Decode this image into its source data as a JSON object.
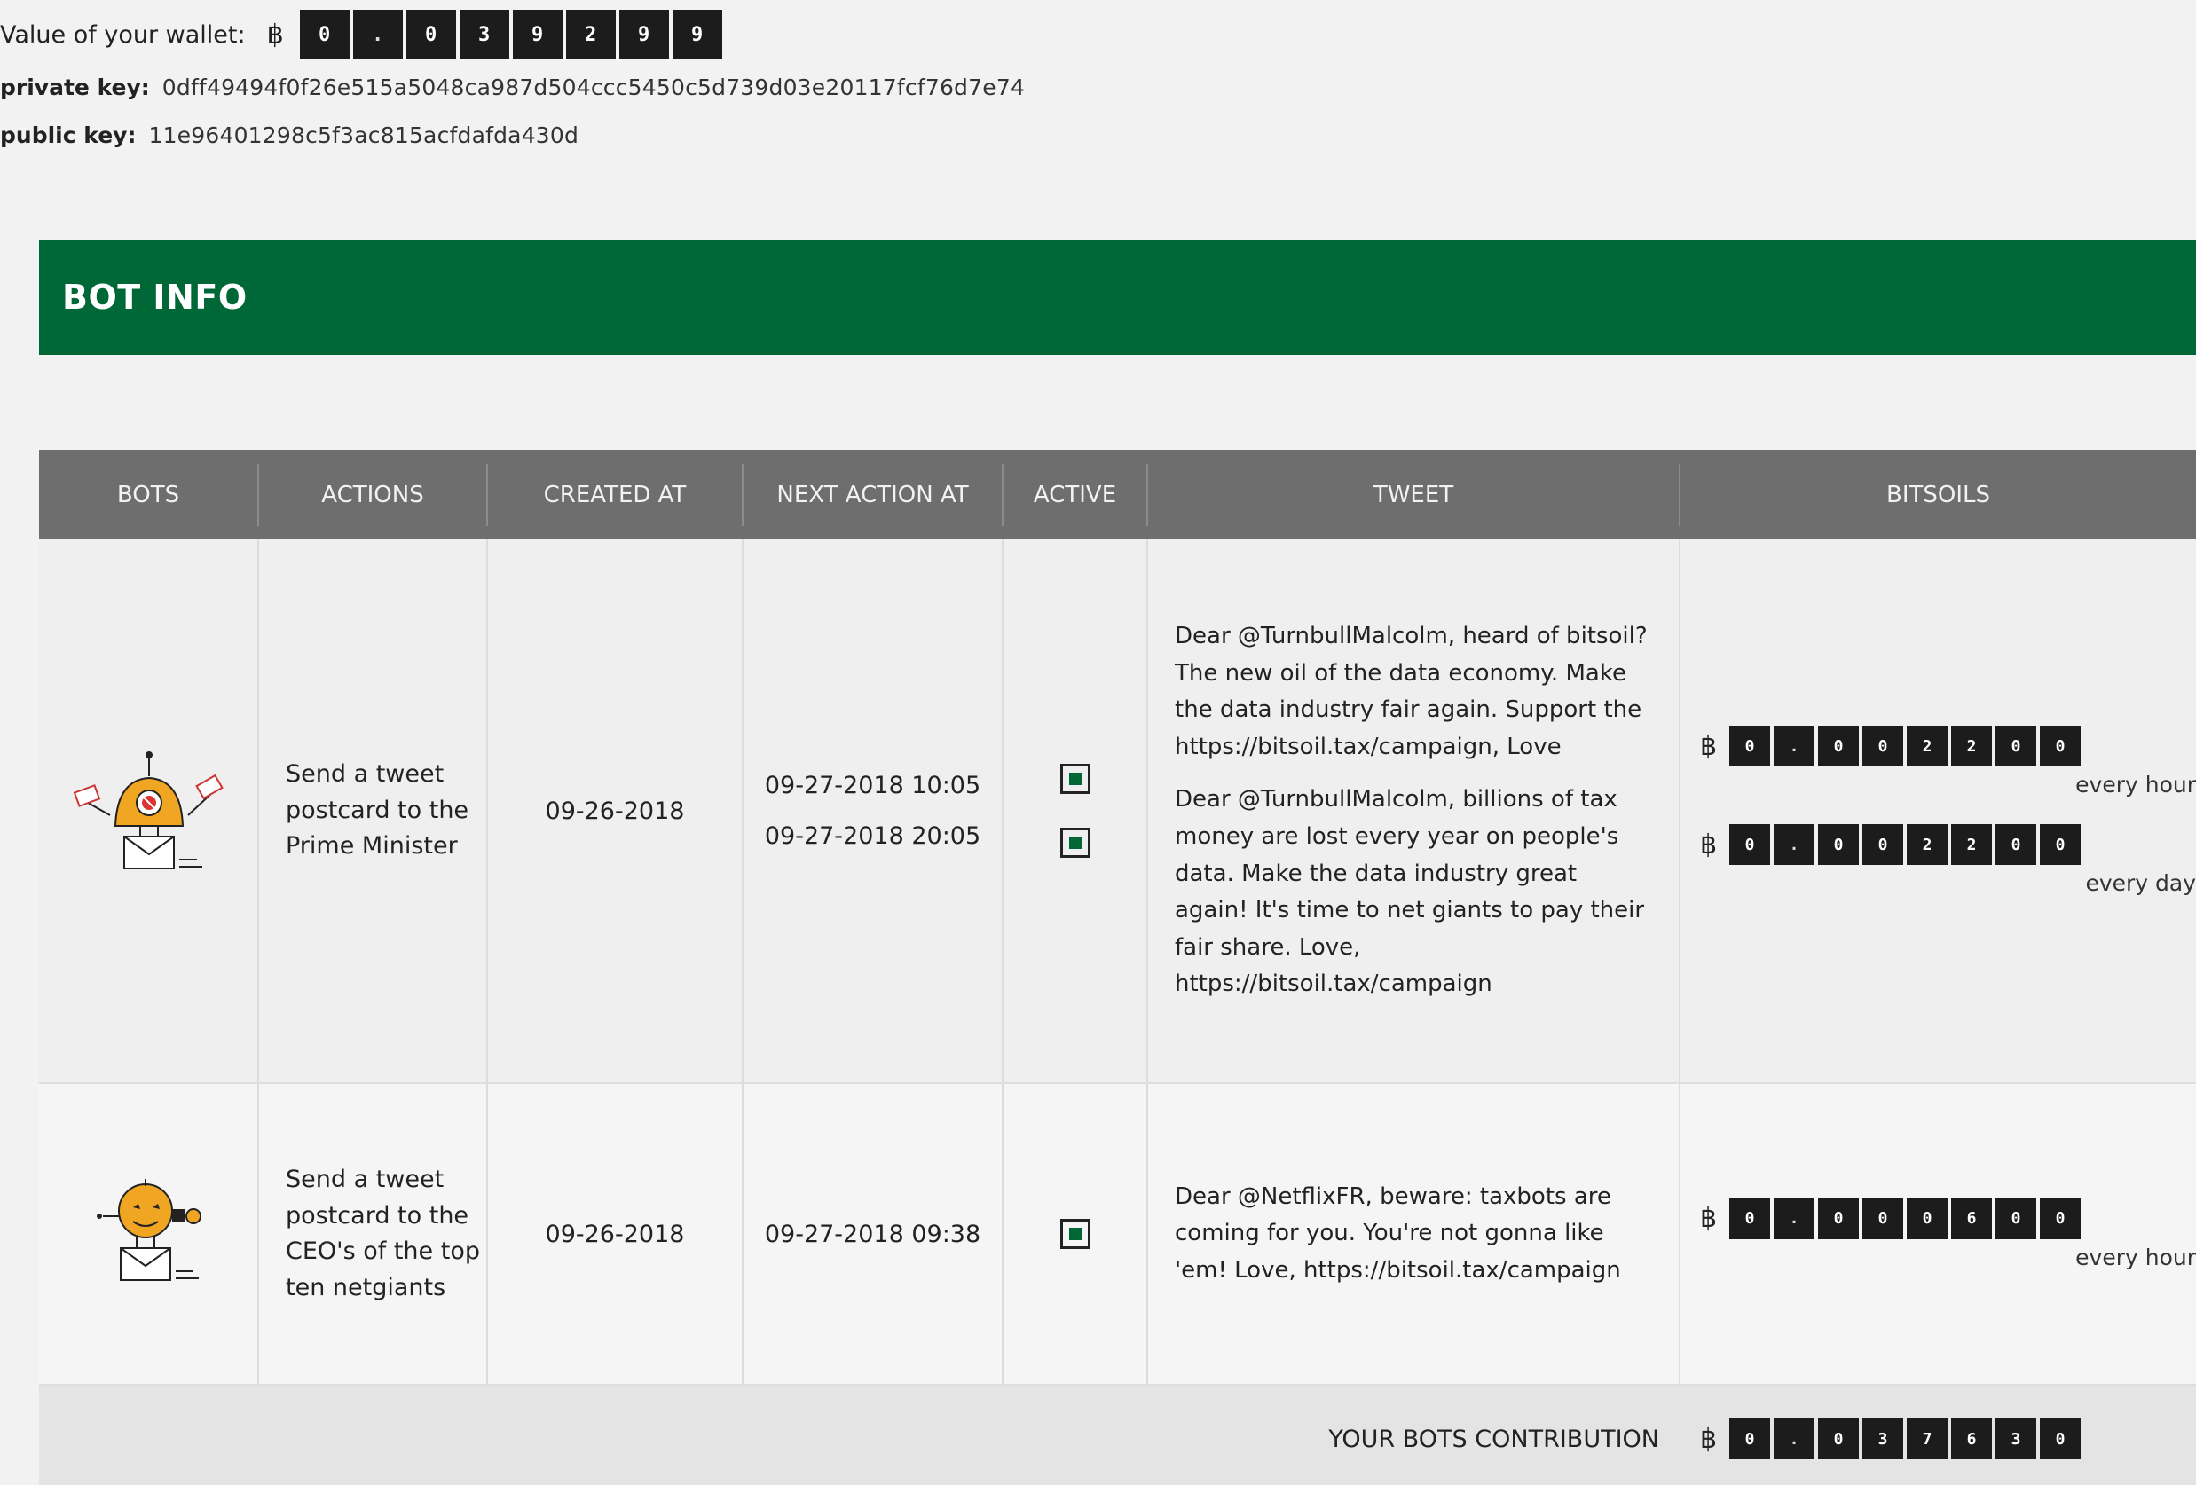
{
  "wallet": {
    "label": "Value of your wallet:",
    "currency_symbol": "฿",
    "digits": [
      "0",
      ".",
      "0",
      "3",
      "9",
      "2",
      "9",
      "9"
    ],
    "private_key_label": "private key:",
    "private_key": "0dff49494f0f26e515a5048ca987d504ccc5450c5d739d03e20117fcf76d7e74",
    "public_key_label": "public key:",
    "public_key": "11e96401298c5f3ac815acfdafda430d"
  },
  "section": {
    "title": "BOT INFO"
  },
  "table": {
    "headers": [
      "BOTS",
      "ACTIONS",
      "CREATED AT",
      "NEXT ACTION AT",
      "ACTIVE",
      "TWEET",
      "BITSOILS"
    ],
    "rows": [
      {
        "action": "Send a tweet postcard to the Prime Minister",
        "created_at": "09-26-2018",
        "next_actions": [
          "09-27-2018 10:05",
          "09-27-2018 20:05"
        ],
        "tweets": [
          "Dear @TurnbullMalcolm, heard of bitsoil? The new oil of the data economy. Make the data industry fair again. Support the https://bitsoil.tax/campaign, Love",
          "Dear @TurnbullMalcolm, billions of tax money are lost every year on people's data. Make the data industry great again! It's time to net giants to pay their fair share. Love, https://bitsoil.tax/campaign"
        ],
        "bitsoils": [
          {
            "digits": [
              "0",
              ".",
              "0",
              "0",
              "2",
              "2",
              "0",
              "0"
            ],
            "frequency": "every hour"
          },
          {
            "digits": [
              "0",
              ".",
              "0",
              "0",
              "2",
              "2",
              "0",
              "0"
            ],
            "frequency": "every day"
          }
        ]
      },
      {
        "action": "Send a tweet postcard to the CEO's of the top ten netgiants",
        "created_at": "09-26-2018",
        "next_actions": [
          "09-27-2018 09:38"
        ],
        "tweets": [
          "Dear @NetflixFR, beware: taxbots are coming for you. You're not gonna like 'em! Love, https://bitsoil.tax/campaign"
        ],
        "bitsoils": [
          {
            "digits": [
              "0",
              ".",
              "0",
              "0",
              "0",
              "6",
              "0",
              "0"
            ],
            "frequency": "every hour"
          }
        ]
      }
    ],
    "total_label": "YOUR BOTS CONTRIBUTION",
    "total_digits": [
      "0",
      ".",
      "0",
      "3",
      "7",
      "6",
      "3",
      "0"
    ]
  }
}
